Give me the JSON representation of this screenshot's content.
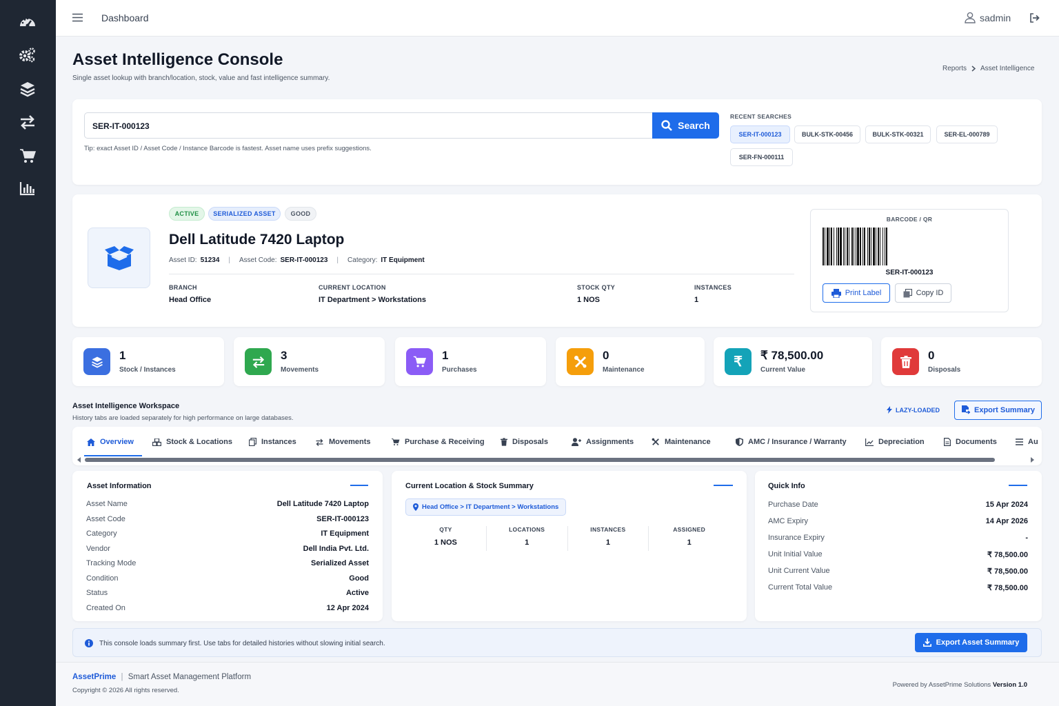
{
  "topbar": {
    "title": "Dashboard",
    "user": "sadmin"
  },
  "header": {
    "title": "Asset Intelligence Console",
    "subtitle": "Single asset lookup with branch/location, stock, value and fast intelligence summary.",
    "breadcrumb": [
      "Reports",
      "Asset Intelligence"
    ]
  },
  "search": {
    "value": "SER-IT-000123",
    "button": "Search",
    "tip": "Tip: exact Asset ID / Asset Code / Instance Barcode is fastest. Asset name uses prefix suggestions.",
    "recent_label": "RECENT SEARCHES",
    "recent": [
      "SER-IT-000123",
      "BULK-STK-00456",
      "BULK-STK-00321",
      "SER-EL-000789",
      "SER-FN-000111"
    ]
  },
  "asset": {
    "badges": [
      "ACTIVE",
      "SERIALIZED ASSET",
      "GOOD"
    ],
    "name": "Dell Latitude 7420 Laptop",
    "id_label": "Asset ID:",
    "id": "51234",
    "code_label": "Asset Code:",
    "code": "SER-IT-000123",
    "cat_label": "Category:",
    "category": "IT Equipment",
    "fields": [
      {
        "label": "BRANCH",
        "value": "Head Office"
      },
      {
        "label": "CURRENT LOCATION",
        "value": "IT Department > Workstations"
      },
      {
        "label": "STOCK QTY",
        "value": "1 NOS"
      },
      {
        "label": "INSTANCES",
        "value": "1"
      }
    ],
    "barcode_label": "BARCODE / QR",
    "barcode_text": "SER-IT-000123",
    "print_label": "Print Label",
    "copy_id": "Copy ID"
  },
  "stats": [
    {
      "value": "1",
      "label": "Stock / Instances",
      "color": "#3b6fe0"
    },
    {
      "value": "3",
      "label": "Movements",
      "color": "#2fa84f"
    },
    {
      "value": "1",
      "label": "Purchases",
      "color": "#8b5cf6"
    },
    {
      "value": "0",
      "label": "Maintenance",
      "color": "#f59e0b"
    },
    {
      "value": "₹ 78,500.00",
      "label": "Current Value",
      "color": "#14a3b8"
    },
    {
      "value": "0",
      "label": "Disposals",
      "color": "#e03a3a"
    }
  ],
  "workspace": {
    "title": "Asset Intelligence Workspace",
    "subtitle": "History tabs are loaded separately for high performance on large databases.",
    "lazy": "LAZY-LOADED",
    "export": "Export Summary"
  },
  "tabs": [
    "Overview",
    "Stock & Locations",
    "Instances",
    "Movements",
    "Purchase & Receiving",
    "Disposals",
    "Assignments",
    "Maintenance",
    "AMC / Insurance / Warranty",
    "Depreciation",
    "Documents",
    "Au"
  ],
  "info": {
    "title": "Asset Information",
    "rows": [
      {
        "k": "Asset Name",
        "v": "Dell Latitude 7420 Laptop"
      },
      {
        "k": "Asset Code",
        "v": "SER-IT-000123"
      },
      {
        "k": "Category",
        "v": "IT Equipment"
      },
      {
        "k": "Vendor",
        "v": "Dell India Pvt. Ltd."
      },
      {
        "k": "Tracking Mode",
        "v": "Serialized Asset"
      },
      {
        "k": "Condition",
        "v": "Good"
      },
      {
        "k": "Status",
        "v": "Active"
      },
      {
        "k": "Created On",
        "v": "12 Apr 2024"
      }
    ]
  },
  "location": {
    "title": "Current Location & Stock Summary",
    "path": "Head Office > IT Department > Workstations",
    "cols": [
      {
        "label": "QTY",
        "value": "1 NOS"
      },
      {
        "label": "LOCATIONS",
        "value": "1"
      },
      {
        "label": "INSTANCES",
        "value": "1"
      },
      {
        "label": "ASSIGNED",
        "value": "1"
      }
    ]
  },
  "quick": {
    "title": "Quick Info",
    "rows": [
      {
        "k": "Purchase Date",
        "v": "15 Apr 2024"
      },
      {
        "k": "AMC Expiry",
        "v": "14 Apr 2026"
      },
      {
        "k": "Insurance Expiry",
        "v": "-"
      },
      {
        "k": "Unit Initial Value",
        "v": "₹ 78,500.00"
      },
      {
        "k": "Unit Current Value",
        "v": "₹ 78,500.00"
      },
      {
        "k": "Current Total Value",
        "v": "₹ 78,500.00"
      }
    ]
  },
  "notice": {
    "text": "This console loads summary first. Use tabs for detailed histories without slowing initial search.",
    "button": "Export Asset Summary"
  },
  "footer": {
    "brand": "AssetPrime",
    "tagline": "Smart Asset Management Platform",
    "copyright": "Copyright © 2026 All rights reserved.",
    "powered": "Powered by AssetPrime Solutions",
    "version": "Version 1.0"
  }
}
